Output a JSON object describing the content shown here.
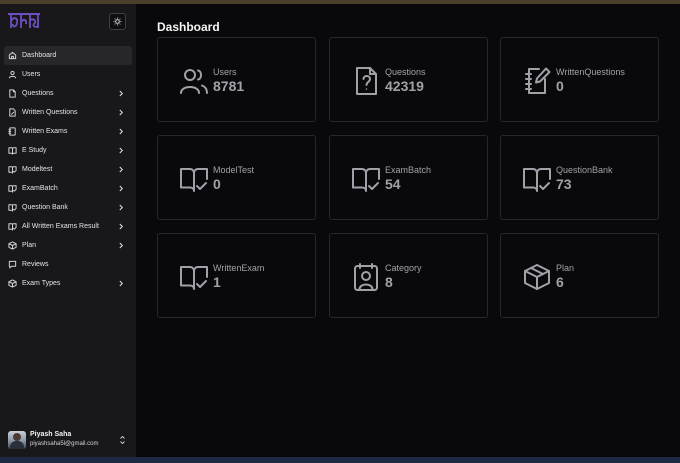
{
  "sidebar": {
    "items": [
      {
        "label": "Dashboard",
        "icon": "home-icon",
        "active": true,
        "chevron": false
      },
      {
        "label": "Users",
        "icon": "user-icon",
        "active": false,
        "chevron": false
      },
      {
        "label": "Questions",
        "icon": "file-icon",
        "active": false,
        "chevron": true
      },
      {
        "label": "Written Questions",
        "icon": "file-edit-icon",
        "active": false,
        "chevron": true
      },
      {
        "label": "Written Exams",
        "icon": "notebook-icon",
        "active": false,
        "chevron": true
      },
      {
        "label": "E Study",
        "icon": "book-icon",
        "active": false,
        "chevron": true
      },
      {
        "label": "Modeltest",
        "icon": "book-check-icon",
        "active": false,
        "chevron": true
      },
      {
        "label": "ExamBatch",
        "icon": "book-check-icon",
        "active": false,
        "chevron": true
      },
      {
        "label": "Question Bank",
        "icon": "book-check-icon",
        "active": false,
        "chevron": true
      },
      {
        "label": "All Written Exams Result",
        "icon": "book-check-icon",
        "active": false,
        "chevron": true
      },
      {
        "label": "Plan",
        "icon": "box-icon",
        "active": false,
        "chevron": true
      },
      {
        "label": "Reviews",
        "icon": "message-icon",
        "active": false,
        "chevron": false
      },
      {
        "label": "Exam Types",
        "icon": "box-icon",
        "active": false,
        "chevron": true
      }
    ]
  },
  "user": {
    "name": "Piyash Saha",
    "email": "piyashsaha5l@gmail.com"
  },
  "main": {
    "title": "Dashboard",
    "cards": [
      {
        "label": "Users",
        "value": "8781",
        "icon": "users-icon"
      },
      {
        "label": "Questions",
        "value": "42319",
        "icon": "file-question-icon"
      },
      {
        "label": "WrittenQuestions",
        "value": "0",
        "icon": "notebook-pen-icon"
      },
      {
        "label": "ModelTest",
        "value": "0",
        "icon": "book-check-icon"
      },
      {
        "label": "ExamBatch",
        "value": "54",
        "icon": "book-check-icon"
      },
      {
        "label": "QuestionBank",
        "value": "73",
        "icon": "book-check-icon"
      },
      {
        "label": "WrittenExam",
        "value": "1",
        "icon": "book-check-icon"
      },
      {
        "label": "Category",
        "value": "8",
        "icon": "contact-icon"
      },
      {
        "label": "Plan",
        "value": "6",
        "icon": "package-icon"
      }
    ]
  },
  "colors": {
    "background": "#09090b",
    "sidebar": "#18181b",
    "border": "#27272a",
    "muted": "#a1a1aa",
    "logo": "#6d4fc2"
  }
}
